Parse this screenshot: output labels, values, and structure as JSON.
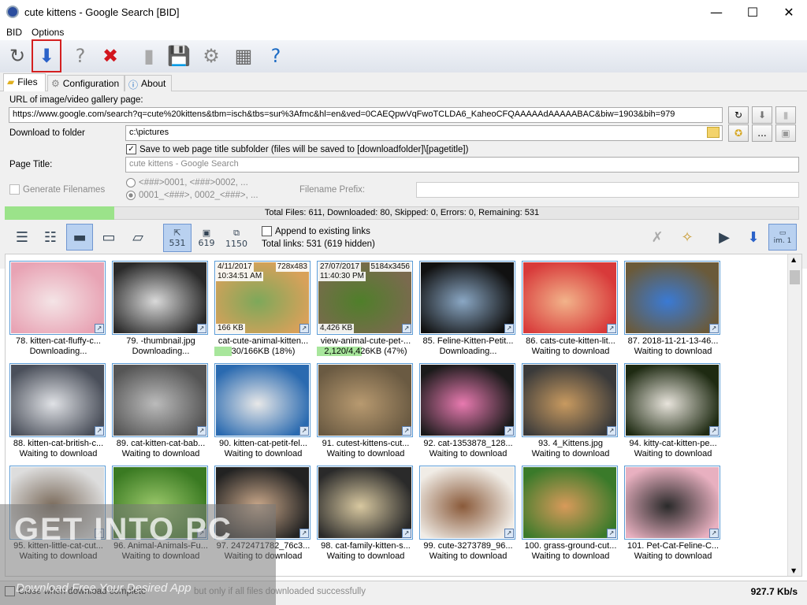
{
  "window": {
    "title": "cute kittens - Google Search [BID]",
    "minimize": "—",
    "maximize": "☐",
    "close": "✕"
  },
  "menu": [
    "BID",
    "Options"
  ],
  "toolbar": [
    {
      "icon": "refresh-icon",
      "glyph": "↻",
      "color": "#555"
    },
    {
      "icon": "download-icon",
      "glyph": "⬇",
      "color": "#2a62c9"
    },
    {
      "icon": "help-icon",
      "glyph": "?",
      "color": "#888"
    },
    {
      "icon": "stop-icon",
      "glyph": "✖",
      "color": "#d2161e"
    },
    {
      "icon": "door-icon",
      "glyph": "▮",
      "color": "#aaa"
    },
    {
      "icon": "save-icon",
      "glyph": "💾",
      "color": "#999"
    },
    {
      "icon": "settings-icon",
      "glyph": "⚙",
      "color": "#888"
    },
    {
      "icon": "grid-icon",
      "glyph": "▦",
      "color": "#666"
    },
    {
      "icon": "manual-icon",
      "glyph": "?",
      "color": "#1c6bc4"
    }
  ],
  "tabs": [
    {
      "label": "Files",
      "icon": "folder-icon"
    },
    {
      "label": "Configuration",
      "icon": "gear-icon"
    },
    {
      "label": "About",
      "icon": "info-icon"
    }
  ],
  "form": {
    "url_label": "URL of image/video gallery page:",
    "url": "https://www.google.com/search?q=cute%20kittens&tbm=isch&tbs=sur%3Afmc&hl=en&ved=0CAEQpwVqFwoTCLDA6_KaheoCFQAAAAAdAAAAABAC&biw=1903&bih=979",
    "folder_label": "Download to folder",
    "folder": "c:\\pictures",
    "subfolder_text": "Save to web page title subfolder (files will be saved to [downloadfolder]\\[pagetitle])",
    "page_title_label": "Page Title:",
    "page_title_value": "cute kittens - Google Search",
    "generate_label": "Generate Filenames",
    "radio1": "<###>0001, <###>0002, ...",
    "radio2": "0001_<###>, 0002_<###>, ...",
    "prefix_label": "Filename Prefix:",
    "browse_dots": "..."
  },
  "progress": {
    "fraction": 0.138,
    "text": "Total Files: 611, Downloaded: 80, Skipped: 0, Errors: 0, Remaining: 531"
  },
  "filters": {
    "count1": "531",
    "count2": "619",
    "count3": "1150",
    "append_label": "Append to existing links",
    "total_links": "Total links: 531 (619 hidden)",
    "img_btn": "im. 1"
  },
  "items": [
    {
      "name": "78. kitten-cat-fluffy-c...",
      "status": "Downloading...",
      "c1": "#e8a3b4",
      "c2": "#f4e4e6"
    },
    {
      "name": "79. -thumbnail.jpg",
      "status": "Downloading...",
      "c1": "#2a2a2a",
      "c2": "#d9d9d9"
    },
    {
      "name": "cat-cute-animal-kitten...",
      "status": "30/166KB (18%)",
      "progress": 0.18,
      "c1": "#d8a15a",
      "c2": "#7da85a",
      "tl": "4/11/2017",
      "tl2": "10:34:51 AM",
      "tr": "728x483",
      "bl": "166 KB"
    },
    {
      "name": "view-animal-cute-pet-...",
      "status": "2,120/4,426KB (47%)",
      "progress": 0.47,
      "c1": "#7a6a4e",
      "c2": "#4f7f2a",
      "tl": "27/07/2017",
      "tl2": "11:40:30 PM",
      "tr": "5184x3456",
      "bl": "4,426 KB"
    },
    {
      "name": "85. Feline-Kitten-Petit...",
      "status": "Downloading...",
      "c1": "#111",
      "c2": "#8aa7c4"
    },
    {
      "name": "86. cats-cute-kitten-lit...",
      "status": "Waiting to download",
      "c1": "#d83a3a",
      "c2": "#f2b38a"
    },
    {
      "name": "87. 2018-11-21-13-46...",
      "status": "Waiting to download",
      "c1": "#6a5a3a",
      "c2": "#3a7ad4"
    },
    {
      "name": "88. kitten-cat-british-c...",
      "status": "Waiting to download",
      "c1": "#4a4f5a",
      "c2": "#e0e2e6"
    },
    {
      "name": "89. cat-kitten-cat-bab...",
      "status": "Waiting to download",
      "c1": "#555",
      "c2": "#bbb"
    },
    {
      "name": "90. kitten-cat-petit-fel...",
      "status": "Waiting to download",
      "c1": "#2a6ab0",
      "c2": "#e8e8e8"
    },
    {
      "name": "91. cutest-kittens-cut...",
      "status": "Waiting to download",
      "c1": "#6a5a42",
      "c2": "#b89a70"
    },
    {
      "name": "92. cat-1353878_128...",
      "status": "Waiting to download",
      "c1": "#1a1a1a",
      "c2": "#e87ab0"
    },
    {
      "name": "93. 4_Kittens.jpg",
      "status": "Waiting to download",
      "c1": "#3a3a3a",
      "c2": "#c89a60"
    },
    {
      "name": "94. kitty-cat-kitten-pe...",
      "status": "Waiting to download",
      "c1": "#1e2a12",
      "c2": "#e8e4dc"
    },
    {
      "name": "95. kitten-little-cat-cut...",
      "status": "Waiting to download",
      "c1": "#ddd",
      "c2": "#7a6a5a"
    },
    {
      "name": "96. Animal-Animals-Fu...",
      "status": "Waiting to download",
      "c1": "#3a7a22",
      "c2": "#9ac76a"
    },
    {
      "name": "97. 2472471782_76c3...",
      "status": "Waiting to download",
      "c1": "#222",
      "c2": "#caa88a"
    },
    {
      "name": "98. cat-family-kitten-s...",
      "status": "Waiting to download",
      "c1": "#2a2a2a",
      "c2": "#d8c8a0"
    },
    {
      "name": "99. cute-3273789_96...",
      "status": "Waiting to download",
      "c1": "#f0ece6",
      "c2": "#8a5a3a"
    },
    {
      "name": "100. grass-ground-cut...",
      "status": "Waiting to download",
      "c1": "#3a7a2a",
      "c2": "#d89a5a"
    },
    {
      "name": "101. Pet-Cat-Feline-C...",
      "status": "Waiting to download",
      "c1": "#e8b0c0",
      "c2": "#2a2a2a"
    }
  ],
  "status": {
    "close_label": "Close when download complete",
    "only_label": "but only if all files downloaded successfully",
    "speed": "927.7 Kb/s"
  },
  "watermark": {
    "big": "GET INTO PC",
    "sub": "Download Free Your Desired App"
  }
}
